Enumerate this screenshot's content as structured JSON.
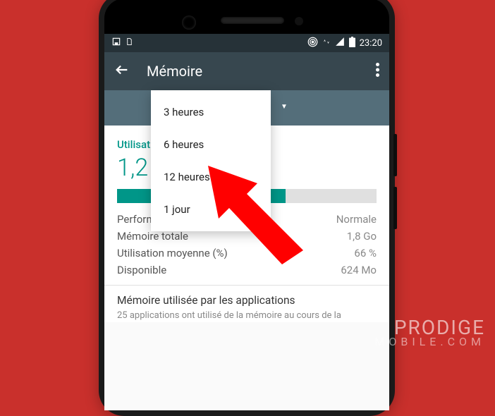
{
  "statusbar": {
    "time": "23:20"
  },
  "appbar": {
    "title": "Mémoire"
  },
  "dropdown": {
    "options": {
      "0": "3 heures",
      "1": "6 heures",
      "2": "12 heures",
      "3": "1 jour"
    }
  },
  "memory": {
    "avg_label_truncated": "Utilisati",
    "avg_value_truncated": "1,2",
    "bar_fill_percent": 65
  },
  "stats": {
    "performance": {
      "label": "Performances",
      "value": "Normale"
    },
    "total": {
      "label": "Mémoire totale",
      "value": "1,8 Go"
    },
    "avg_pct": {
      "label": "Utilisation moyenne (%)",
      "value": "66 %"
    },
    "available": {
      "label": "Disponible",
      "value": "624 Mo"
    }
  },
  "apps_section": {
    "title": "Mémoire utilisée par les applications",
    "subtitle": "25 applications ont utilisé de la mémoire au cours de la"
  },
  "watermark": {
    "brand": "PRODIGE",
    "sub": "MOBILE.COM"
  }
}
